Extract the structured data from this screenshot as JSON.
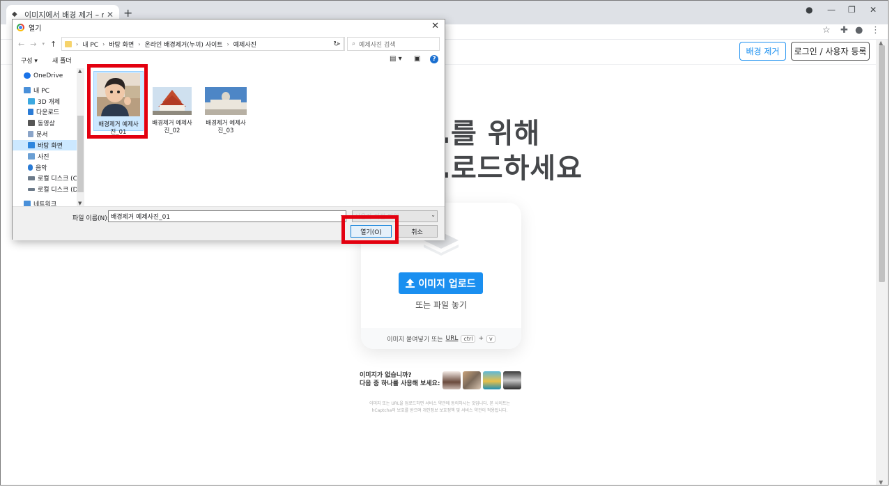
{
  "browser": {
    "tab_title": "이미지에서 배경 제거 – remove.bg",
    "tab_close": "✕",
    "new_tab": "+",
    "win_min": "—",
    "win_restore": "❐",
    "win_close": "✕"
  },
  "site": {
    "header": {
      "remove_bg_label": "배경 제거",
      "login_label": "로그인 / 사용자 등록"
    },
    "hero_line1": "…를 위해",
    "hero_line2": "…로드하세요",
    "upload_button": "이미지 업로드",
    "or_drop": "또는 파일 놓기",
    "paste_text": "이미지 붙여넣기 또는",
    "paste_url": "URL",
    "kbd_ctrl": "ctrl",
    "kbd_plus": "+",
    "kbd_v": "v",
    "no_image_line1": "이미지가 없습니까?",
    "no_image_line2": "다음 중 하나를 사용해 보세요:",
    "terms_line1": "이미지 또는 URL을 업로드하면 서비스 약관에 동의하시는 것입니다. 본 사이트는",
    "terms_line2": "hCaptcha의 보호를 받으며 개인정보 보호정책 및 서비스 약관이 적용됩니다."
  },
  "dialog": {
    "title": "열기",
    "close": "✕",
    "breadcrumb": [
      "내 PC",
      "바탕 화면",
      "온라인 배경제거(누끼) 사이트",
      "예제사진"
    ],
    "search_placeholder": "예제사진 검색",
    "cmd_organize": "구성 ▾",
    "cmd_new_folder": "새 폴더",
    "help": "?",
    "sidebar": [
      {
        "label": "OneDrive",
        "color": "#1a73e8"
      },
      {
        "label": "내 PC",
        "color": "#4a90d9"
      },
      {
        "label": "3D 개체",
        "color": "#3ba8e0"
      },
      {
        "label": "다운로드",
        "color": "#2a7bd5"
      },
      {
        "label": "동영상",
        "color": "#555555"
      },
      {
        "label": "문서",
        "color": "#8aa4c8"
      },
      {
        "label": "바탕 화면",
        "color": "#2e86de"
      },
      {
        "label": "사진",
        "color": "#6a9fd4"
      },
      {
        "label": "음악",
        "color": "#2a7bd5"
      },
      {
        "label": "로컬 디스크 (C:)",
        "color": "#6c7a89"
      },
      {
        "label": "로컬 디스크 (D:)",
        "color": "#6c7a89"
      },
      {
        "label": "네트워크",
        "color": "#4a90d9"
      }
    ],
    "files": [
      {
        "name_line1": "배경제거 예제사",
        "name_line2": "진_01"
      },
      {
        "name_line1": "배경제거 예제사",
        "name_line2": "진_02"
      },
      {
        "name_line1": "배경제거 예제사",
        "name_line2": "진_03"
      }
    ],
    "filename_label": "파일 이름(N):",
    "filename_value": "배경제거 예제사진_01",
    "filetype_value": "사용자 지정 파일",
    "open_button": "열기(O)",
    "cancel_button": "취소"
  },
  "colors": {
    "accent": "#1a8ff0",
    "highlight": "#e3000f",
    "selection": "#cce8ff"
  }
}
